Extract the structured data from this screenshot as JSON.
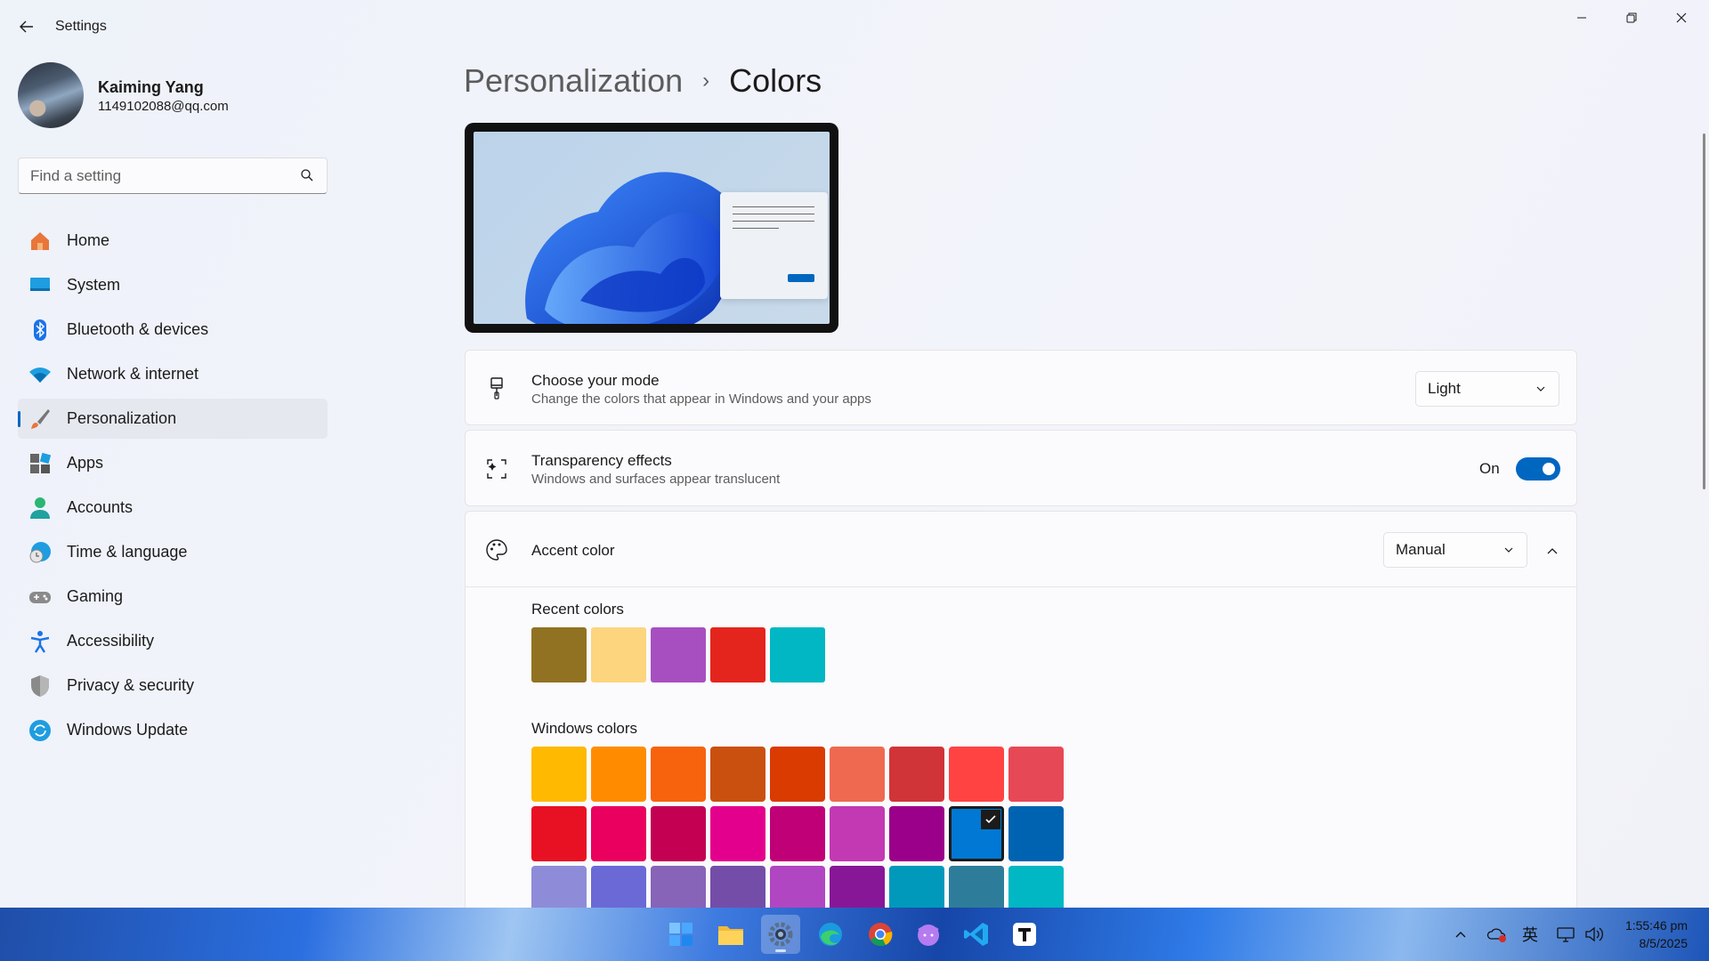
{
  "app": {
    "title": "Settings"
  },
  "user": {
    "name": "Kaiming Yang",
    "email": "1149102088@qq.com"
  },
  "search": {
    "placeholder": "Find a setting"
  },
  "nav": {
    "items": [
      {
        "label": "Home",
        "icon": "home-icon"
      },
      {
        "label": "System",
        "icon": "system-icon"
      },
      {
        "label": "Bluetooth & devices",
        "icon": "bluetooth-icon"
      },
      {
        "label": "Network & internet",
        "icon": "wifi-icon"
      },
      {
        "label": "Personalization",
        "icon": "brush-icon",
        "active": true
      },
      {
        "label": "Apps",
        "icon": "apps-icon"
      },
      {
        "label": "Accounts",
        "icon": "person-icon"
      },
      {
        "label": "Time & language",
        "icon": "clock-globe-icon"
      },
      {
        "label": "Gaming",
        "icon": "gamepad-icon"
      },
      {
        "label": "Accessibility",
        "icon": "accessibility-icon"
      },
      {
        "label": "Privacy & security",
        "icon": "shield-icon"
      },
      {
        "label": "Windows Update",
        "icon": "update-icon"
      }
    ]
  },
  "breadcrumb": {
    "parent": "Personalization",
    "separator": "›",
    "current": "Colors"
  },
  "mode": {
    "title": "Choose your mode",
    "subtitle": "Change the colors that appear in Windows and your apps",
    "value": "Light"
  },
  "transparency": {
    "title": "Transparency effects",
    "subtitle": "Windows and surfaces appear translucent",
    "state_label": "On",
    "on": true
  },
  "accent": {
    "title": "Accent color",
    "value": "Manual",
    "recent_label": "Recent colors",
    "recent": [
      "#917222",
      "#fdd57f",
      "#a74fc1",
      "#e3251d",
      "#00b7c3"
    ],
    "windows_label": "Windows colors",
    "windows_colors": [
      [
        "#ffb900",
        "#ff8c00",
        "#f7630c",
        "#ca5010",
        "#da3b01",
        "#ef6950",
        "#d13438",
        "#ff4343",
        "#e74856"
      ],
      [
        "#e81123",
        "#ea005e",
        "#c30052",
        "#e3008c",
        "#bf0077",
        "#c239b3",
        "#9a0089",
        "#0078d4",
        "#0063b1"
      ],
      [
        "#8e8cd8",
        "#6b69d6",
        "#8764b8",
        "#744da9",
        "#b146c2",
        "#881798",
        "#0099bc",
        "#2d7d9a",
        "#00b7c3"
      ]
    ],
    "selected": {
      "row": 1,
      "col": 7
    }
  },
  "taskbar": {
    "apps": [
      "windows-start-icon",
      "file-explorer-icon",
      "settings-icon",
      "edge-icon",
      "chrome-icon",
      "cat-app-icon",
      "vscode-icon",
      "typora-icon"
    ],
    "tray": {
      "ime": "英"
    },
    "time": "1:55:46 pm",
    "date": "8/5/2025"
  }
}
